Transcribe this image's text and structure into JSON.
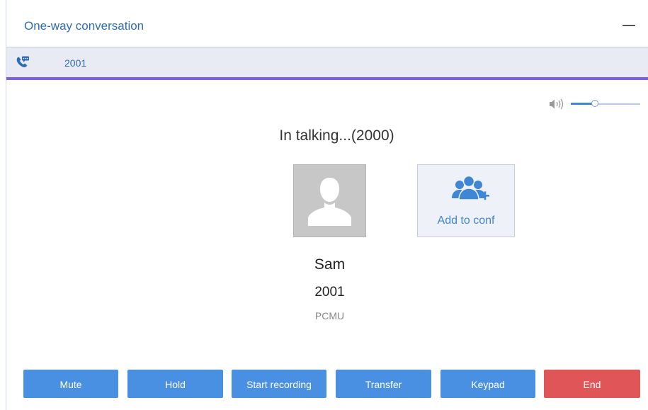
{
  "window": {
    "title": "One-way conversation"
  },
  "tab": {
    "label": "2001",
    "icon": "phone-chat-icon"
  },
  "volume": {
    "icon": "speaker-icon",
    "level": 0.35
  },
  "call": {
    "status": "In talking...(2000)",
    "contact_name": "Sam",
    "contact_number": "2001",
    "codec": "PCMU",
    "avatar_icon": "person-placeholder-icon"
  },
  "conference": {
    "label": "Add to conf",
    "icon": "add-group-icon"
  },
  "actions": {
    "mute": "Mute",
    "hold": "Hold",
    "record": "Start recording",
    "transfer": "Transfer",
    "keypad": "Keypad",
    "end": "End"
  },
  "colors": {
    "accent": "#4a90e2",
    "end": "#e05558",
    "tab_underline": "#7b61e0",
    "title": "#2f6db3"
  }
}
